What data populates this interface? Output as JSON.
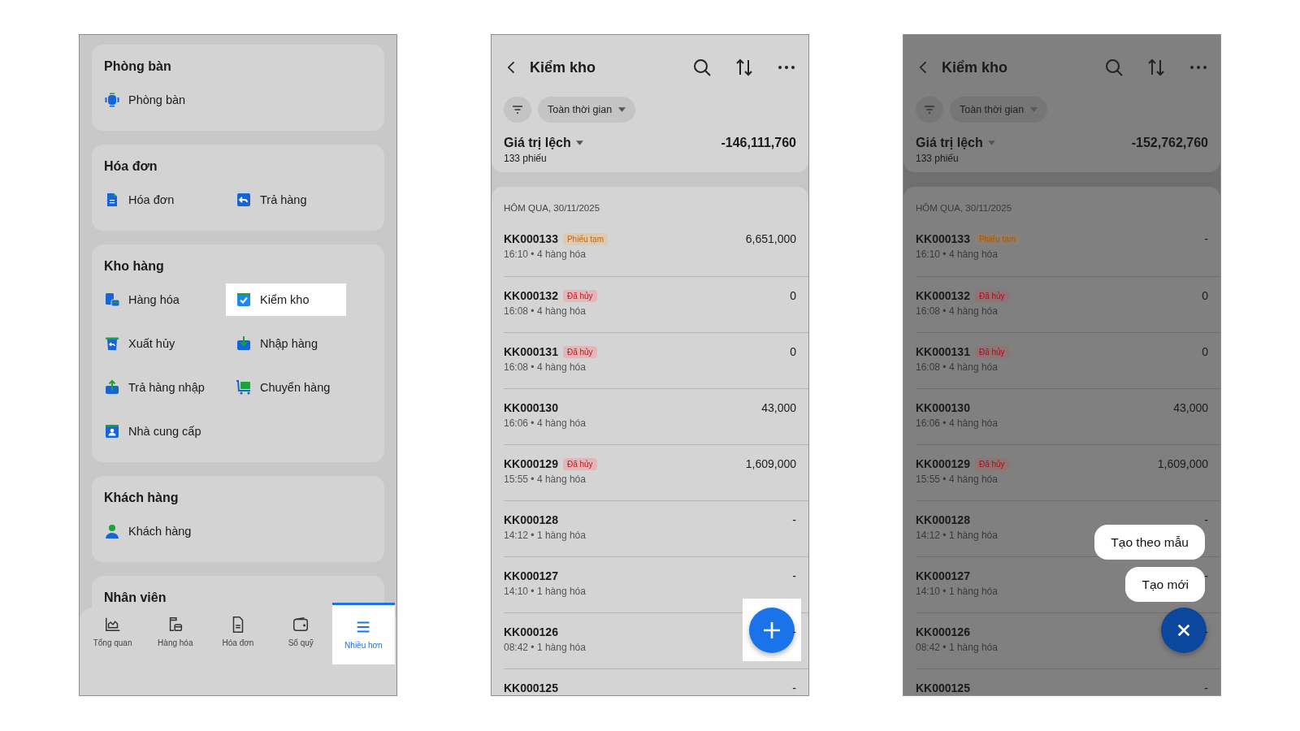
{
  "screens": [
    {
      "kind": "menu",
      "sections": [
        {
          "title": "Phòng bàn",
          "items": [
            {
              "label": "Phòng bàn",
              "highlighted": false
            }
          ]
        },
        {
          "title": "Hóa đơn",
          "items": [
            {
              "label": "Hóa đơn",
              "highlighted": false
            },
            {
              "label": "Trả hàng",
              "highlighted": false
            }
          ]
        },
        {
          "title": "Kho hàng",
          "items": [
            {
              "label": "Hàng hóa",
              "highlighted": false
            },
            {
              "label": "Kiểm kho",
              "highlighted": true
            },
            {
              "label": "Xuất hủy",
              "highlighted": false
            },
            {
              "label": "Nhập hàng",
              "highlighted": false
            },
            {
              "label": "Trả hàng nhập",
              "highlighted": false
            },
            {
              "label": "Chuyển hàng",
              "highlighted": false
            },
            {
              "label": "Nhà cung cấp",
              "highlighted": false
            }
          ]
        },
        {
          "title": "Khách hàng",
          "items": [
            {
              "label": "Khách hàng",
              "highlighted": false
            }
          ]
        },
        {
          "title": "Nhân viên"
        }
      ],
      "bottom_nav": [
        {
          "label": "Tổng quan",
          "selected": false
        },
        {
          "label": "Hàng hóa",
          "selected": false
        },
        {
          "label": "Hóa đơn",
          "selected": false
        },
        {
          "label": "Sổ quỹ",
          "selected": false
        },
        {
          "label": "Nhiều hơn",
          "selected": true
        }
      ]
    },
    {
      "kind": "list",
      "dimmed": false,
      "title": "Kiểm kho",
      "filter_chip": "Toàn thời gian",
      "summary": {
        "label": "Giá trị lệch",
        "count": "133 phiếu",
        "value": "-146,111,760"
      },
      "group_header": "HÔM QUA, 30/11/2025",
      "rows": [
        {
          "code": "KK000133",
          "tag": {
            "text": "Phiếu tạm",
            "kind": "draft"
          },
          "sub": "16:10 • 4 hàng hóa",
          "value": "6,651,000"
        },
        {
          "code": "KK000132",
          "tag": {
            "text": "Đã hủy",
            "kind": "cancelled"
          },
          "sub": "16:08 • 4 hàng hóa",
          "value": "0"
        },
        {
          "code": "KK000131",
          "tag": {
            "text": "Đã hủy",
            "kind": "cancelled"
          },
          "sub": "16:08 • 4 hàng hóa",
          "value": "0"
        },
        {
          "code": "KK000130",
          "sub": "16:06 • 4 hàng hóa",
          "value": "43,000"
        },
        {
          "code": "KK000129",
          "tag": {
            "text": "Đã hủy",
            "kind": "cancelled"
          },
          "sub": "15:55 • 4 hàng hóa",
          "value": "1,609,000"
        },
        {
          "code": "KK000128",
          "sub": "14:12 • 1 hàng hóa",
          "value": "-"
        },
        {
          "code": "KK000127",
          "sub": "14:10 • 1 hàng hóa",
          "value": "-"
        },
        {
          "code": "KK000126",
          "sub": "08:42 • 1 hàng hóa",
          "value": "-"
        },
        {
          "code": "KK000125",
          "value": "-"
        }
      ],
      "fab": {
        "open": false,
        "highlighted": true
      }
    },
    {
      "kind": "list",
      "dimmed": true,
      "title": "Kiểm kho",
      "filter_chip": "Toàn thời gian",
      "summary": {
        "label": "Giá trị lệch",
        "count": "133 phiếu",
        "value": "-152,762,760"
      },
      "group_header": "HÔM QUA, 30/11/2025",
      "rows": [
        {
          "code": "KK000133",
          "tag": {
            "text": "Phiếu tạm",
            "kind": "draft"
          },
          "sub": "16:10 • 4 hàng hóa",
          "value": "-"
        },
        {
          "code": "KK000132",
          "tag": {
            "text": "Đã hủy",
            "kind": "cancelled"
          },
          "sub": "16:08 • 4 hàng hóa",
          "value": "0"
        },
        {
          "code": "KK000131",
          "tag": {
            "text": "Đã hủy",
            "kind": "cancelled"
          },
          "sub": "16:08 • 4 hàng hóa",
          "value": "0"
        },
        {
          "code": "KK000130",
          "sub": "16:06 • 4 hàng hóa",
          "value": "43,000"
        },
        {
          "code": "KK000129",
          "tag": {
            "text": "Đã hủy",
            "kind": "cancelled"
          },
          "sub": "15:55 • 4 hàng hóa",
          "value": "1,609,000"
        },
        {
          "code": "KK000128",
          "sub": "14:12 • 1 hàng hóa",
          "value": "-"
        },
        {
          "code": "KK000127",
          "sub": "14:10 • 1 hàng hóa",
          "value": "-"
        },
        {
          "code": "KK000126",
          "sub": "08:42 • 1 hàng hóa",
          "value": "-"
        },
        {
          "code": "KK000125",
          "value": "-"
        }
      ],
      "fab": {
        "open": true,
        "highlighted": false
      },
      "fab_menu": [
        "Tạo theo mẫu",
        "Tạo mới"
      ]
    }
  ]
}
